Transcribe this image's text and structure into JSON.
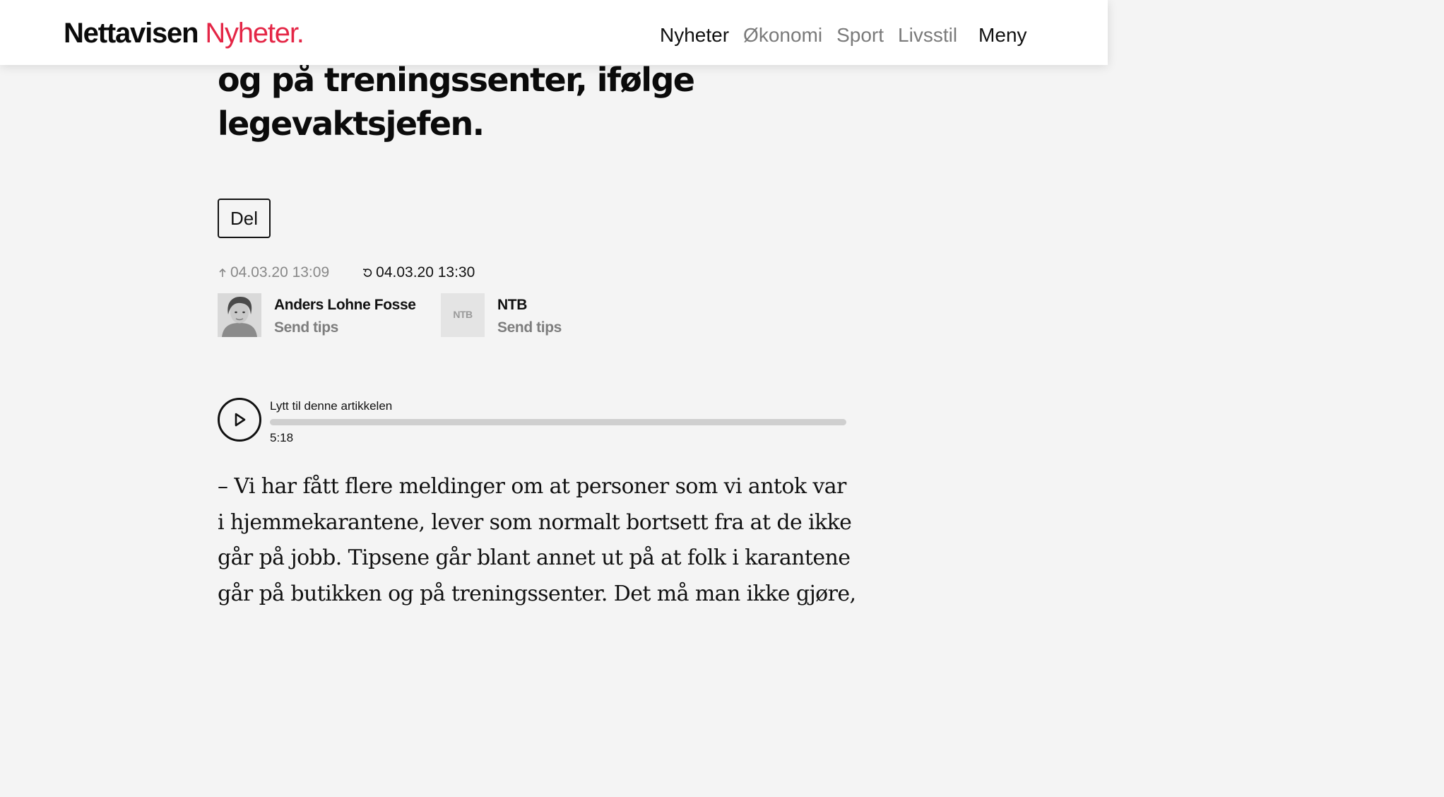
{
  "header": {
    "logo_main": "Nettavisen",
    "logo_accent": "Nyheter.",
    "nav_items": [
      {
        "label": "Nyheter",
        "active": true
      },
      {
        "label": "Økonomi",
        "active": false
      },
      {
        "label": "Sport",
        "active": false
      },
      {
        "label": "Livsstil",
        "active": false
      }
    ],
    "menu_label": "Meny"
  },
  "article": {
    "headline_lines": [
      "og på treningssenter, ifølge",
      "legevaktsjefen."
    ],
    "share_label": "Del",
    "published": "04.03.20 13:09",
    "updated": "04.03.20 13:30",
    "authors": [
      {
        "name": "Anders Lohne Fosse",
        "tips_label": "Send tips",
        "avatar_icon": "person-photo"
      },
      {
        "name": "NTB",
        "tips_label": "Send tips",
        "avatar_icon": "ntb-logo",
        "avatar_text": "NTB"
      }
    ],
    "audio": {
      "label": "Lytt til denne artikkelen",
      "duration": "5:18",
      "progress": 0
    },
    "body_lines": [
      "– Vi har fått flere meldinger om at personer som vi antok var",
      "i hjemmekarantene, lever som normalt bortsett fra at de ikke",
      "går på jobb. Tipsene går blant annet ut på at folk i karantene",
      "går på butikken og på treningssenter. Det må man ikke gjøre,"
    ]
  },
  "colors": {
    "brand_red": "#e42646",
    "background": "#f4f4f4",
    "text": "#111111",
    "muted": "#7d7d7d"
  }
}
